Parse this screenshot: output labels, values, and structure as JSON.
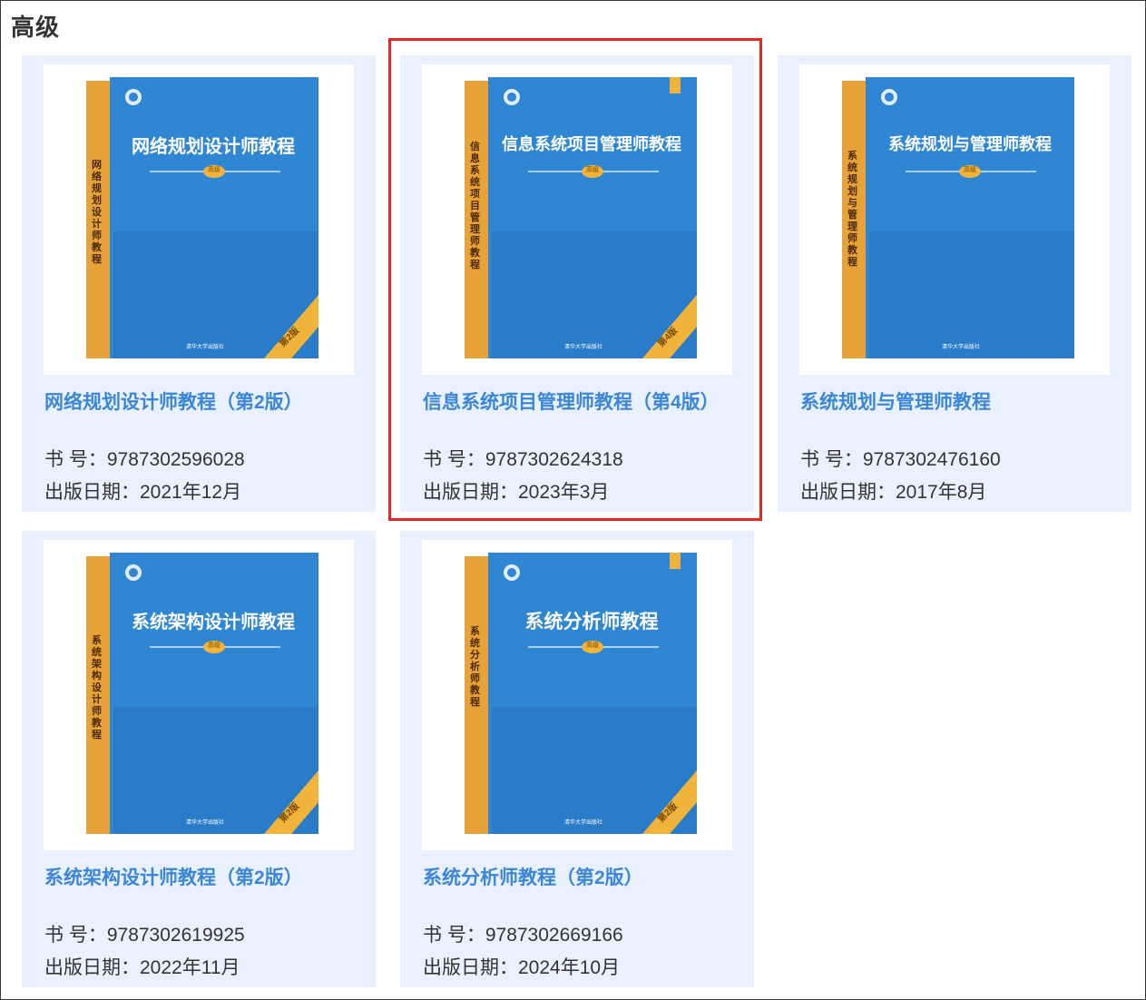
{
  "section": {
    "title": "高级"
  },
  "colors": {
    "link": "#3b86d8",
    "card_bg": "#e8f1fd",
    "highlight": "#e02828",
    "cover_blue": "#2f86d3",
    "spine_orange": "#e8a23a"
  },
  "highlighted_index": 1,
  "books": [
    {
      "title": "网络规划设计师教程（第2版）",
      "isbn_label": "书 号：",
      "isbn": "9787302596028",
      "date_label": "出版日期：",
      "date": "2021年12月",
      "cover": {
        "title": "网络规划设计师教程",
        "spine": "网络规划设计师教程",
        "badge": "高级",
        "edition": "第2版",
        "publisher": "清华大学出版社"
      }
    },
    {
      "title": "信息系统项目管理师教程（第4版）",
      "isbn_label": "书 号：",
      "isbn": "9787302624318",
      "date_label": "出版日期：",
      "date": "2023年3月",
      "cover": {
        "title": "信息系统项目管理师教程",
        "spine": "信息系统项目管理师教程",
        "badge": "高级",
        "edition": "第4版",
        "publisher": "清华大学出版社"
      }
    },
    {
      "title": "系统规划与管理师教程",
      "isbn_label": "书 号：",
      "isbn": "9787302476160",
      "date_label": "出版日期：",
      "date": "2017年8月",
      "cover": {
        "title": "系统规划与管理师教程",
        "spine": "系统规划与管理师教程",
        "badge": "高级",
        "edition": "",
        "publisher": "清华大学出版社"
      }
    },
    {
      "title": "系统架构设计师教程（第2版）",
      "isbn_label": "书 号：",
      "isbn": "9787302619925",
      "date_label": "出版日期：",
      "date": "2022年11月",
      "cover": {
        "title": "系统架构设计师教程",
        "spine": "系统架构设计师教程",
        "badge": "高级",
        "edition": "第2版",
        "publisher": "清华大学出版社"
      }
    },
    {
      "title": "系统分析师教程（第2版）",
      "isbn_label": "书 号：",
      "isbn": "9787302669166",
      "date_label": "出版日期：",
      "date": "2024年10月",
      "cover": {
        "title": "系统分析师教程",
        "spine": "系统分析师教程",
        "badge": "高级",
        "edition": "第2版",
        "publisher": "清华大学出版社"
      }
    }
  ]
}
